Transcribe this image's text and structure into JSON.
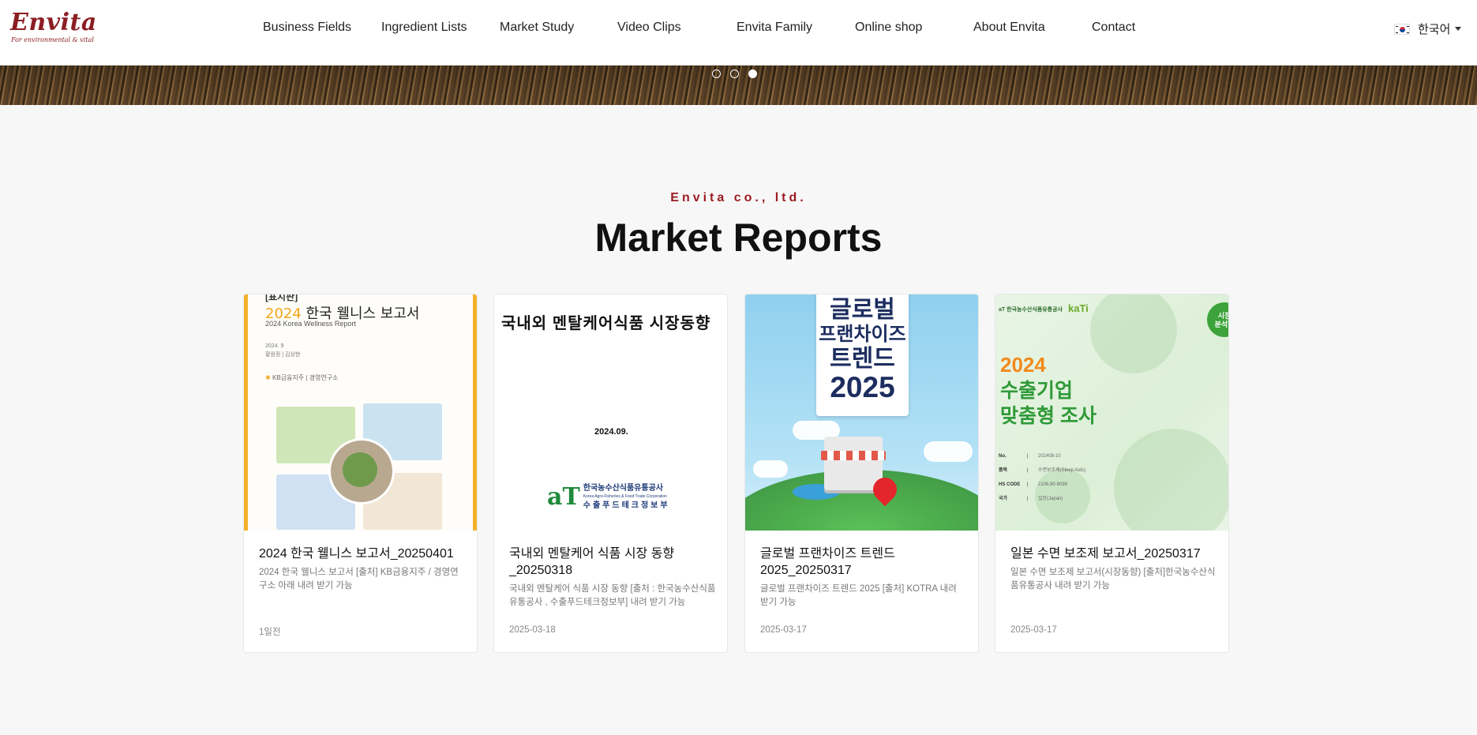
{
  "header": {
    "logo_text": "Envita",
    "logo_tagline": "For environmental & vital",
    "nav": [
      {
        "label": "Business Fields"
      },
      {
        "label": "Ingredient Lists"
      },
      {
        "label": "Market Study"
      },
      {
        "label": "Video Clips"
      },
      {
        "label": "Envita Family"
      },
      {
        "label": "Online shop"
      },
      {
        "label": "About Envita"
      },
      {
        "label": "Contact"
      }
    ],
    "language": {
      "label": "한국어",
      "flag": "korea-flag-icon"
    }
  },
  "hero": {
    "slides_total": 3,
    "active_slide": 3
  },
  "section": {
    "eyebrow": "Envita co., ltd.",
    "title": "Market Reports"
  },
  "colors": {
    "brand": "#8b1e23",
    "eyebrow": "#9b1c22",
    "accent_yellow": "#f3b12a",
    "accent_green": "#2f9a38"
  },
  "cards": [
    {
      "title": "2024 한국 웰니스 보고서_20250401",
      "description": "2024 한국 웰니스 보고서 [출처] KB금융지주 / 경영연구소 아래 내려 받기 가능",
      "date": "1일전",
      "thumb": {
        "topcut": "[표지판]",
        "year": "2024",
        "heading": "한국 웰니스 보고서",
        "subtitle": "2024 Korea Wellness Report",
        "meta1": "2024. 9",
        "meta2": "황원정 | 김상현",
        "org_prefix": "KB금융지주",
        "org_suffix": "|  경영연구소"
      }
    },
    {
      "title": "국내외 멘탈케어 식품 시장 동향_20250318",
      "description": "국내외 멘탈케어 식품 시장 동향 [출처 : 한국농수산식품유통공사 , 수출푸드테크정보부] 내려 받기 가능",
      "date": "2025-03-18",
      "thumb": {
        "heading": "국내외  멘탈케어식품  시장동향",
        "date": "2024.09.",
        "org_mark": "aT",
        "org_name": "한국농수산식품유통공사",
        "org_en": "Korea Agro-Fisheries & Food Trade Corporation",
        "org_dept": "수출푸드테크정보부"
      }
    },
    {
      "title": "글로벌 프랜차이즈 트렌드 2025_20250317",
      "description": "글로벌 프랜차이즈 트렌드 2025 [출처] KOTRA 내려 받기 가능",
      "date": "2025-03-17",
      "thumb": {
        "line1": "글로벌",
        "line2": "프랜차이즈",
        "line3": "트렌드",
        "line4": "2025"
      }
    },
    {
      "title": "일본 수면 보조제 보고서_20250317",
      "description": "일본 수면 보조제 보고서(시장동향) [출처]한국농수산식품유통공사 내려 받기 가능",
      "date": "2025-03-17",
      "thumb": {
        "org": "한국농수산식품유통공사",
        "kati": "kaTi",
        "badge1": "시장",
        "badge2": "분석형",
        "year": "2024",
        "line1": "수출기업",
        "line2": "맞춤형 조사",
        "rows": [
          {
            "k": "No.",
            "v": "202408-10"
          },
          {
            "k": "품목",
            "v": "수면보조제(Sleep Aids)"
          },
          {
            "k": "HS CODE",
            "v": "2106.90-9099"
          },
          {
            "k": "국가",
            "v": "일본(Japan)"
          }
        ]
      }
    }
  ]
}
